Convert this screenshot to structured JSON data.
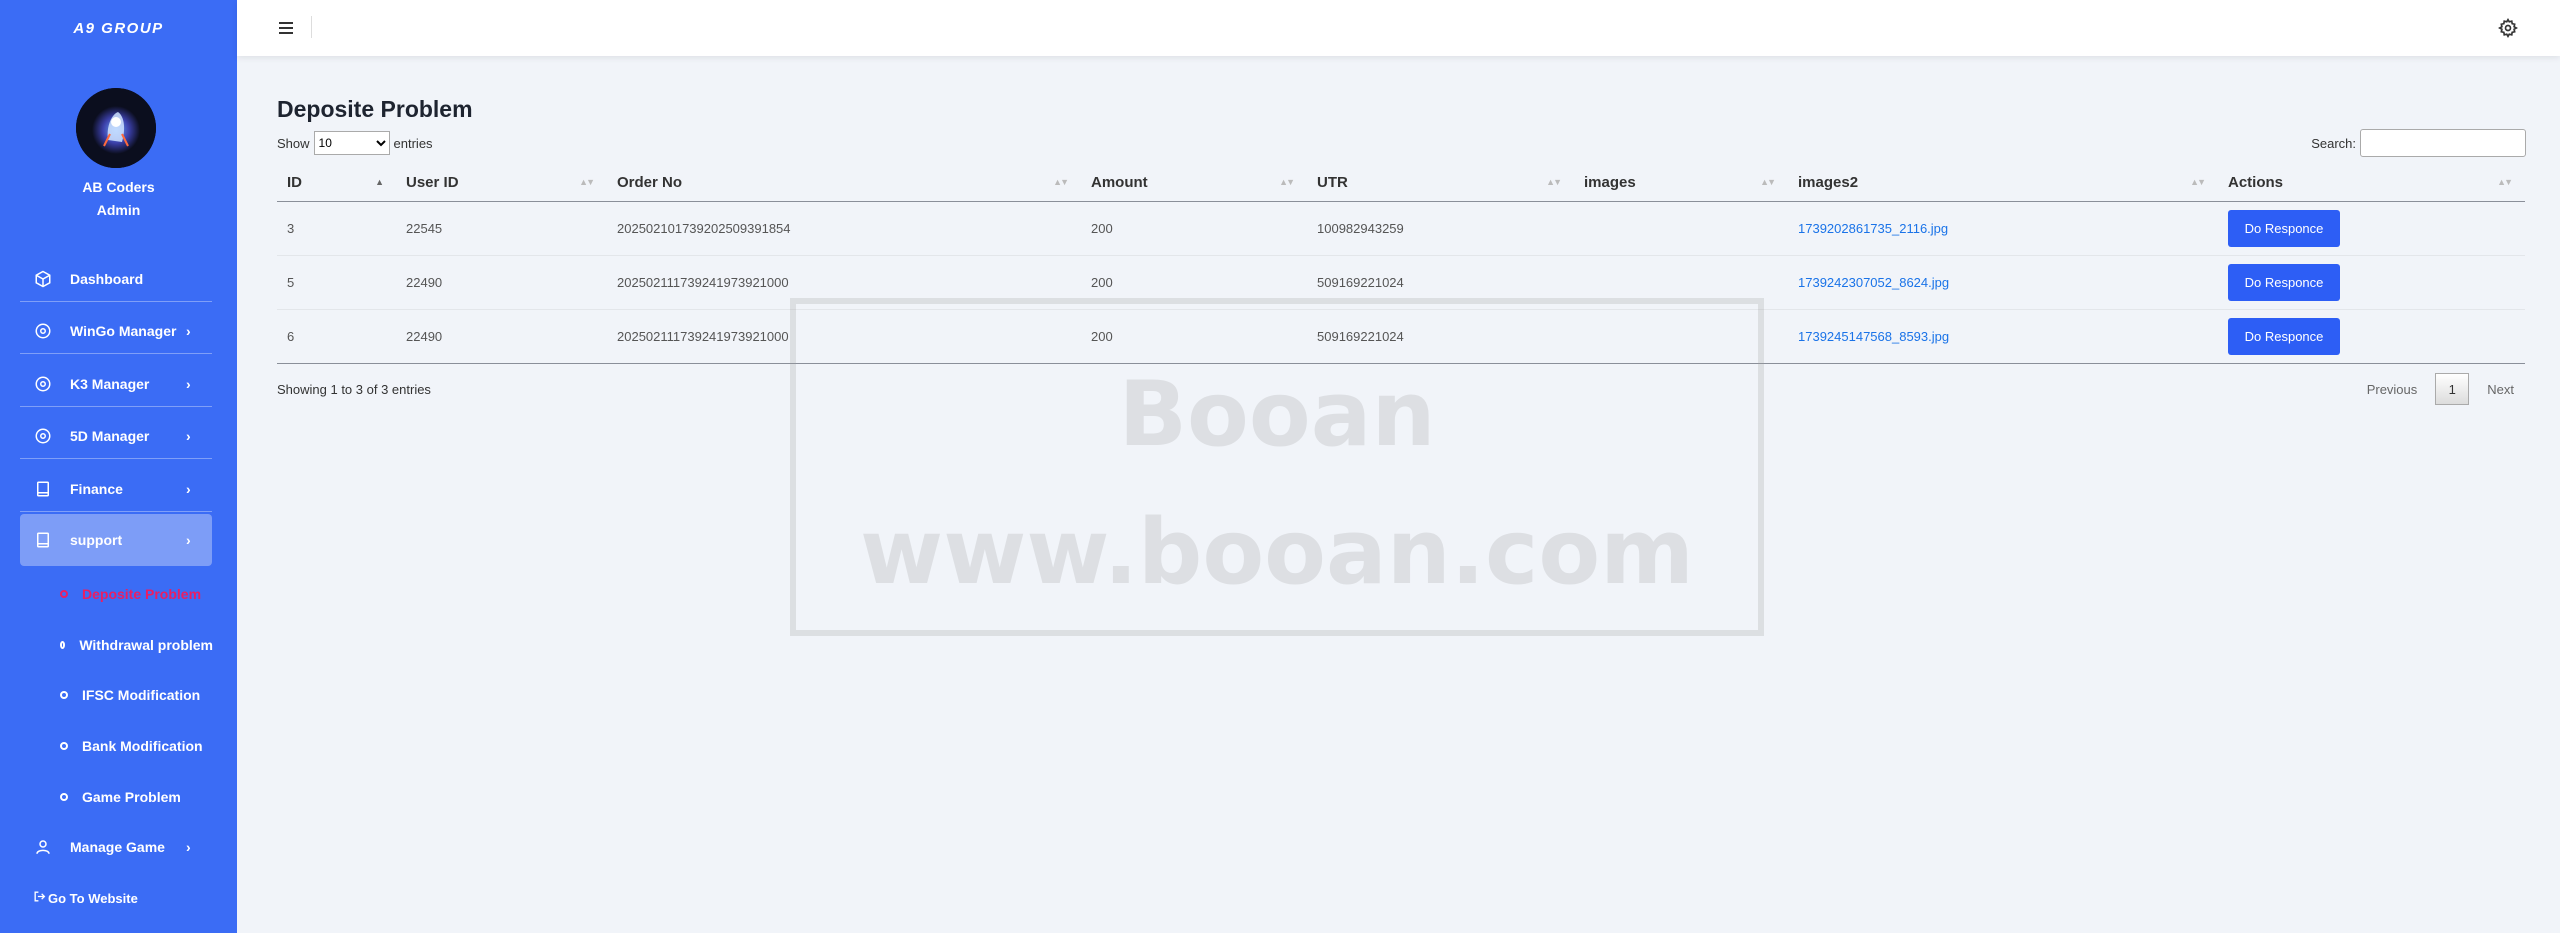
{
  "brand": "A9 GROUP",
  "user": {
    "name": "AB Coders",
    "role": "Admin"
  },
  "nav": {
    "dashboard": "Dashboard",
    "wingo": "WinGo Manager",
    "k3": "K3 Manager",
    "fived": "5D Manager",
    "finance": "Finance",
    "support": "support",
    "manage_game": "Manage Game"
  },
  "support_sub": [
    "Deposite Problem",
    "Withdrawal problem",
    "IFSC Modification",
    "Bank Modification",
    "Game Problem"
  ],
  "go_website": "Go To Website",
  "page": {
    "title": "Deposite Problem"
  },
  "length": {
    "show": "Show",
    "selected": "10",
    "entries": "entries"
  },
  "search": {
    "label": "Search:"
  },
  "table": {
    "headers": [
      "ID",
      "User ID",
      "Order No",
      "Amount",
      "UTR",
      "images",
      "images2",
      "Actions"
    ],
    "rows": [
      {
        "id": "3",
        "user_id": "22545",
        "order_no": "2025021017392025093918‌54",
        "amount": "200",
        "utr": "100982943259",
        "images": "",
        "images2": "1739202861735_2116.jpg",
        "action": "Do Responce"
      },
      {
        "id": "5",
        "user_id": "22490",
        "order_no": "20250211173924197392100‌0",
        "amount": "200",
        "utr": "509169221024",
        "images": "",
        "images2": "1739242307052_8624.jpg",
        "action": "Do Responce"
      },
      {
        "id": "6",
        "user_id": "22490",
        "order_no": "20250211173924197392100‌0",
        "amount": "200",
        "utr": "509169221024",
        "images": "",
        "images2": "1739245147568_8593.jpg",
        "action": "Do Responce"
      }
    ]
  },
  "info": "Showing 1 to 3 of 3 entries",
  "pager": {
    "previous": "Previous",
    "current": "1",
    "next": "Next"
  },
  "watermark": {
    "line1": "Booan",
    "line2": "www.booan.com"
  },
  "colors": {
    "sidebar": "#3b6cf5",
    "active_sub": "#e91e63",
    "button": "#2d5ef5",
    "link": "#1a73e8"
  }
}
